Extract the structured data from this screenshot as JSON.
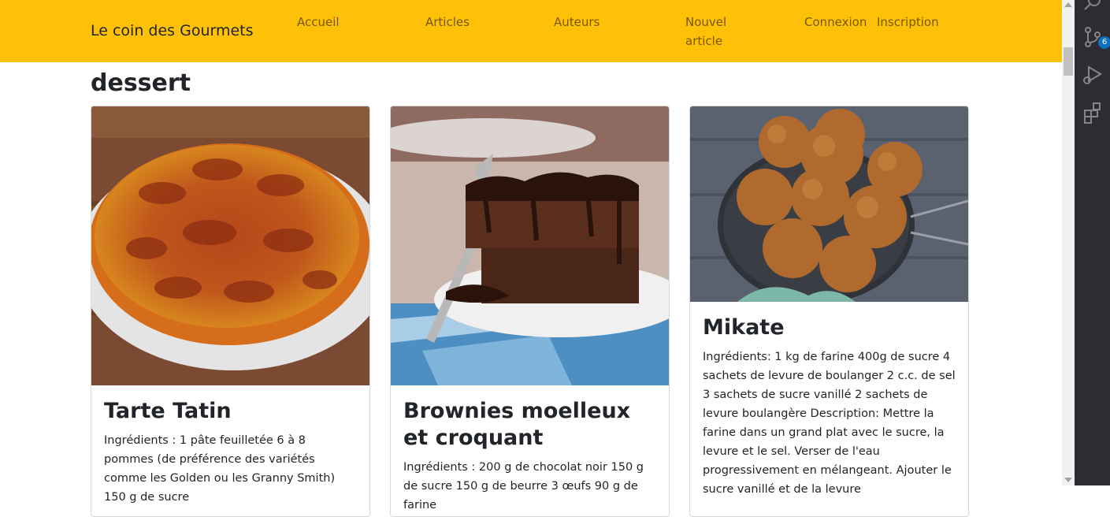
{
  "navbar": {
    "brand": "Le coin des Gourmets",
    "links": [
      "Accueil",
      "Articles",
      "Auteurs",
      "Nouvel article",
      "Connexion",
      "Inscription"
    ]
  },
  "page": {
    "title": "dessert"
  },
  "cards": [
    {
      "title": "Tarte Tatin",
      "text": "Ingrédients : 1 pâte feuilletée 6 à 8 pommes (de préférence des variétés comme les Golden ou les Granny Smith) 150 g de sucre"
    },
    {
      "title": "Brownies moelleux et croquant",
      "text": "Ingrédients : 200 g de chocolat noir 150 g de sucre 150 g de beurre 3 œufs 90 g de farine"
    },
    {
      "title": "Mikate",
      "text": "Ingrédients: 1 kg de farine 400g de sucre 4 sachets de levure de boulanger 2 c.c. de sel 3 sachets de sucre vanillé 2 sachets de levure boulangère Description: Mettre la farine dans un grand plat avec le sucre, la levure et le sel. Verser de l'eau progressivement en mélangeant. Ajouter le sucre vanillé et de la levure"
    }
  ],
  "activity_bar": {
    "icons": [
      "search-icon",
      "source-control-icon",
      "run-debug-icon",
      "extensions-icon"
    ],
    "source_control_badge": "6"
  }
}
